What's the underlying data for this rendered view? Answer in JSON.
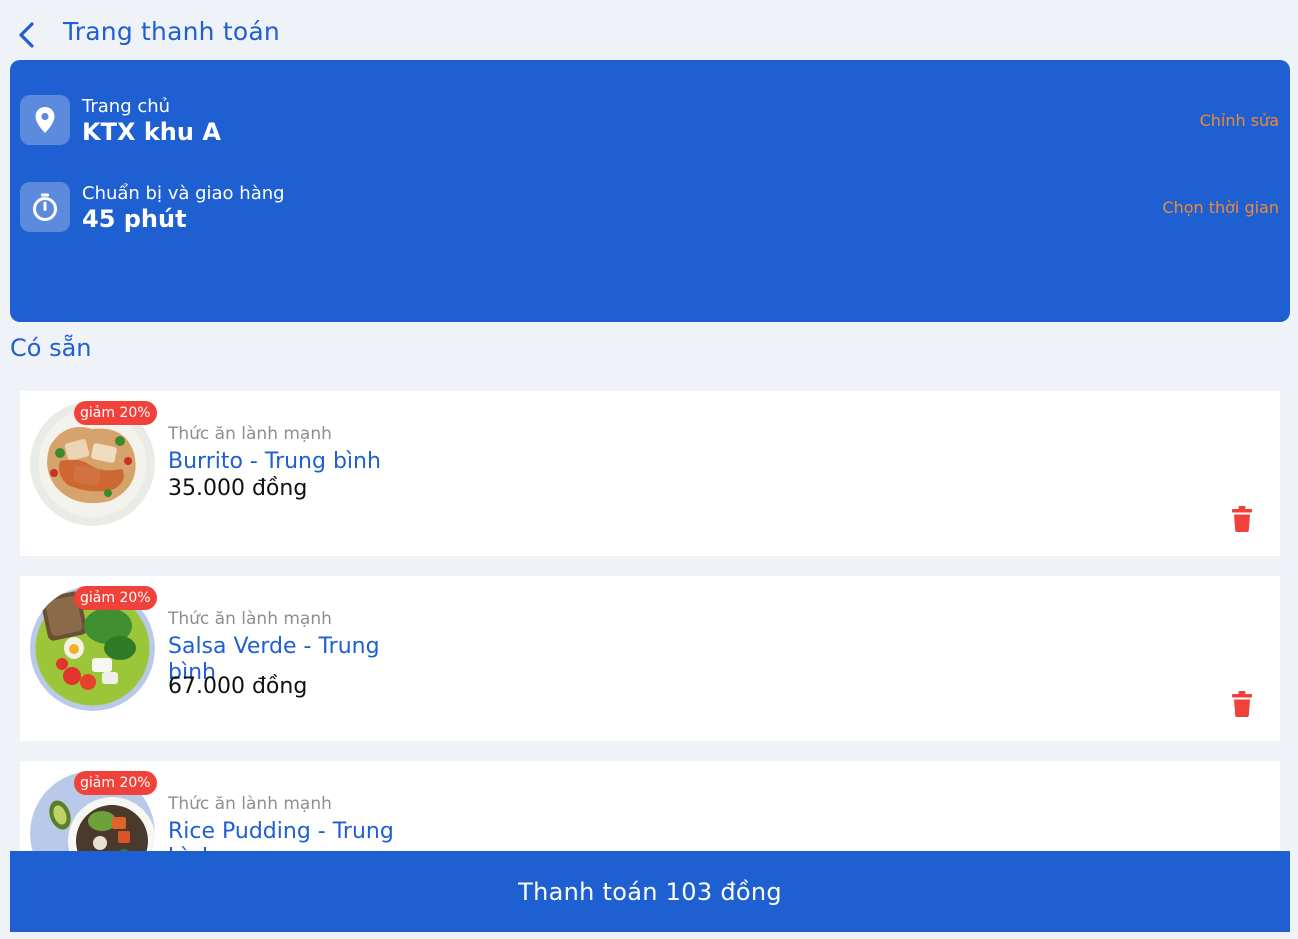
{
  "header": {
    "back_icon": "chevron-left-icon",
    "title": "Trang thanh toán"
  },
  "delivery": {
    "address": {
      "icon": "map-pin-icon",
      "label": "Trang chủ",
      "value": "KTX khu A",
      "action": "Chỉnh sửa"
    },
    "time": {
      "icon": "stopwatch-icon",
      "label": "Chuẩn bị và giao hàng",
      "value": "45 phút",
      "action": "Chọn thời gian"
    }
  },
  "section_title": "Có sẵn",
  "items": [
    {
      "discount": "giảm 20%",
      "category": "Thức ăn lành mạnh",
      "name": "Burrito - Trung bình",
      "price": "35.000 đồng",
      "image": "salad-bowl-photo",
      "delete_icon": "trash-icon"
    },
    {
      "discount": "giảm 20%",
      "category": "Thức ăn lành mạnh",
      "name": "Salsa Verde - Trung bình",
      "price": "67.000 đồng",
      "image": "green-plate-photo",
      "delete_icon": "trash-icon"
    },
    {
      "discount": "giảm 20%",
      "category": "Thức ăn lành mạnh",
      "name": "Rice Pudding - Trung bình",
      "price": "",
      "image": "avocado-bowl-photo",
      "delete_icon": "trash-icon"
    }
  ],
  "checkout": {
    "label": "Thanh toán 103 đồng"
  },
  "colors": {
    "primary": "#1e5fd2",
    "accent": "#ee8a36",
    "badge": "#f0423b",
    "delete": "#f0423b",
    "background": "#eff3f7"
  }
}
